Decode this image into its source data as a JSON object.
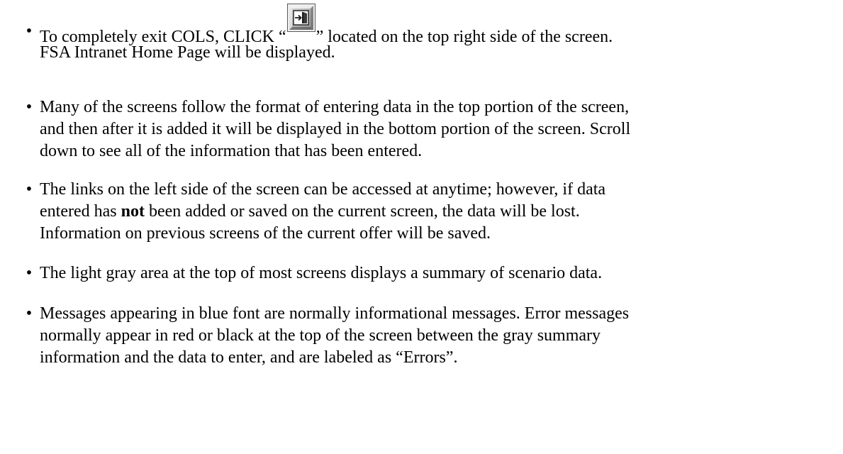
{
  "items": [
    {
      "line1_pre": "To completely exit COLS, CLICK “",
      "icon": "exit-door-icon",
      "line1_post": "” located on the top right side of the screen.",
      "line2": "FSA Intranet Home Page will be displayed."
    },
    {
      "lines": [
        "Many of the screens follow the format of entering data in the top portion of the screen,",
        "and then after it is added it will be displayed in the bottom portion of the screen.  Scroll",
        "down to see all of the information that has been entered."
      ]
    },
    {
      "line1": "The links on the left side of the screen can be accessed at anytime; however, if data",
      "line2_pre": "entered has ",
      "line2_bold": "not",
      "line2_post": " been added or saved on the current screen, the data will be lost.",
      "line3": "Information on previous screens of the current offer will be saved."
    },
    {
      "line1": "The light gray area at the top of most screens displays a summary of scenario data."
    },
    {
      "lines": [
        "Messages appearing in blue font are normally informational messages.  Error messages",
        "normally appear in red or black at the top of the screen between the gray summary",
        "information and the data to enter, and are labeled as “Errors”."
      ]
    }
  ],
  "bullet": "•"
}
